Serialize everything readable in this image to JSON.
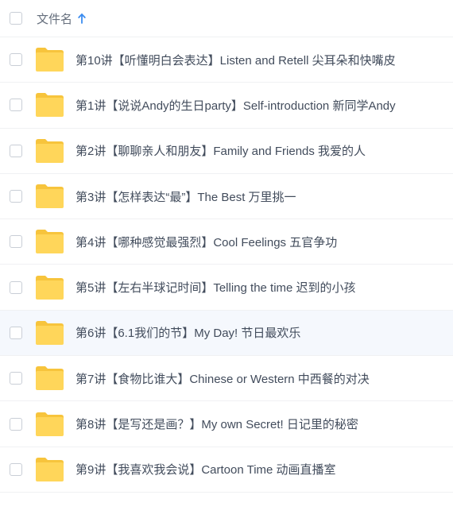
{
  "header": {
    "column_label": "文件名",
    "sort_direction": "ascending",
    "sort_icon": "arrow-up-icon",
    "accent_color": "#3b8cf0"
  },
  "files": [
    {
      "name": "第10讲【听懂明白会表达】Listen and Retell 尖耳朵和快嘴皮",
      "icon": "folder-icon"
    },
    {
      "name": "第1讲【说说Andy的生日party】Self-introduction 新同学Andy",
      "icon": "folder-icon"
    },
    {
      "name": "第2讲【聊聊亲人和朋友】Family and Friends 我爱的人",
      "icon": "folder-icon"
    },
    {
      "name": "第3讲【怎样表达“最”】The Best 万里挑一",
      "icon": "folder-icon"
    },
    {
      "name": "第4讲【哪种感觉最强烈】Cool Feelings 五官争功",
      "icon": "folder-icon"
    },
    {
      "name": "第5讲【左右半球记时间】Telling the time 迟到的小孩",
      "icon": "folder-icon"
    },
    {
      "name": "第6讲【6.1我们的节】My Day! 节日最欢乐",
      "icon": "folder-icon",
      "hovered": true
    },
    {
      "name": "第7讲【食物比谁大】Chinese or Western 中西餐的对决",
      "icon": "folder-icon"
    },
    {
      "name": "第8讲【是写还是画？】My own Secret! 日记里的秘密",
      "icon": "folder-icon"
    },
    {
      "name": "第9讲【我喜欢我会说】Cartoon Time 动画直播室",
      "icon": "folder-icon"
    }
  ],
  "colors": {
    "folder_body": "#ffd65a",
    "folder_tab": "#f7c43c",
    "row_hover": "#f5f8fd"
  }
}
